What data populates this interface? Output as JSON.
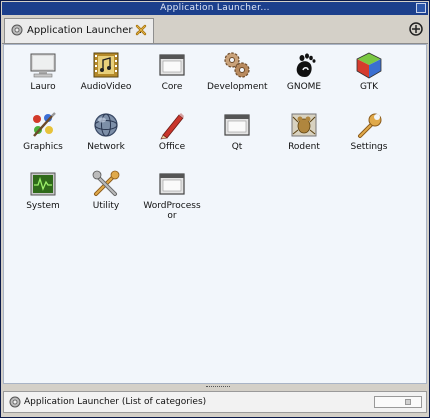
{
  "window": {
    "title": "Application Launcher..."
  },
  "tab": {
    "label": "Application Launcher ..."
  },
  "items": [
    {
      "label": "Lauro"
    },
    {
      "label": "AudioVideo"
    },
    {
      "label": "Core"
    },
    {
      "label": "Development"
    },
    {
      "label": "GNOME"
    },
    {
      "label": "GTK"
    },
    {
      "label": "Graphics"
    },
    {
      "label": "Network"
    },
    {
      "label": "Office"
    },
    {
      "label": "Qt"
    },
    {
      "label": "Rodent"
    },
    {
      "label": "Settings"
    },
    {
      "label": "System"
    },
    {
      "label": "Utility"
    },
    {
      "label": "WordProcessor"
    }
  ],
  "status": {
    "text": "Application Launcher (List of categories)"
  }
}
